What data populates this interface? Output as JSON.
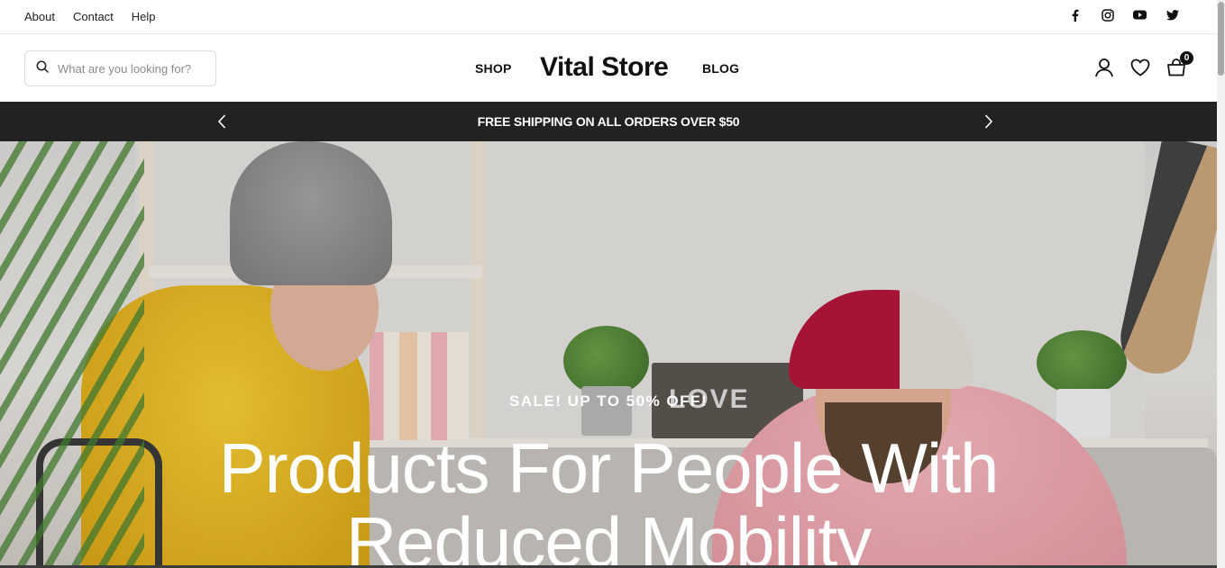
{
  "topbar": {
    "links": [
      "About",
      "Contact",
      "Help"
    ],
    "social_icons": [
      "facebook-icon",
      "instagram-icon",
      "youtube-icon",
      "twitter-icon"
    ]
  },
  "header": {
    "search_placeholder": "What are you looking for?",
    "nav_left": "SHOP",
    "logo": "Vital Store",
    "nav_right": "BLOG",
    "cart_count": "0",
    "icons": [
      "account-icon",
      "wishlist-icon",
      "cart-icon"
    ]
  },
  "announcement": {
    "message": "FREE SHIPPING ON ALL ORDERS OVER $50",
    "background": "#222222"
  },
  "hero": {
    "eyebrow": "SALE! UP TO 50% OFF!",
    "title_line1": "Products For People With",
    "title_line2": "Reduced Mobility",
    "image_text": "LOVE"
  }
}
